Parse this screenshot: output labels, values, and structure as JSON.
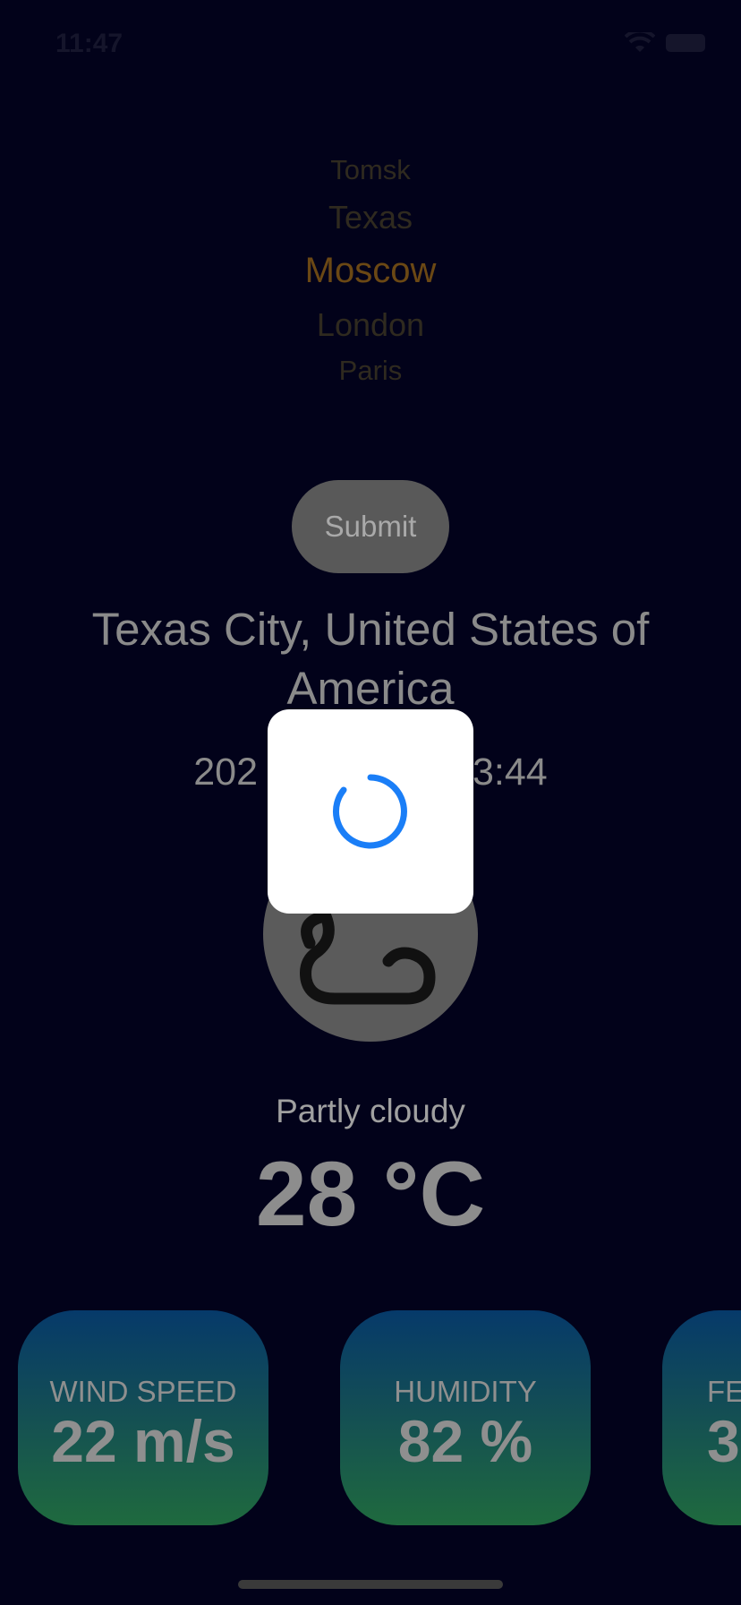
{
  "status_bar": {
    "time": "11:47"
  },
  "city_picker": {
    "items": [
      "Tomsk",
      "Texas",
      "Moscow",
      "London",
      "Paris"
    ],
    "selected": "Moscow"
  },
  "submit": {
    "label": "Submit"
  },
  "weather": {
    "location": "Texas City, United States of America",
    "datetime_visible_left": "202",
    "datetime_visible_right": "3:44",
    "condition": "Partly cloudy",
    "temperature": "28 °C",
    "icon": "cloud-icon"
  },
  "cards": [
    {
      "label": "WIND SPEED",
      "value": "22 m/s"
    },
    {
      "label": "HUMIDITY",
      "value": "82 %"
    },
    {
      "label": "FE",
      "value": "3"
    }
  ],
  "loading": {
    "icon": "spinner-icon",
    "color": "#1a7ef7"
  },
  "colors": {
    "background": "#02021a",
    "selected_picker": "#6b4814",
    "card_gradient_top": "#063a6a",
    "card_gradient_bottom": "#1f6a3e"
  }
}
